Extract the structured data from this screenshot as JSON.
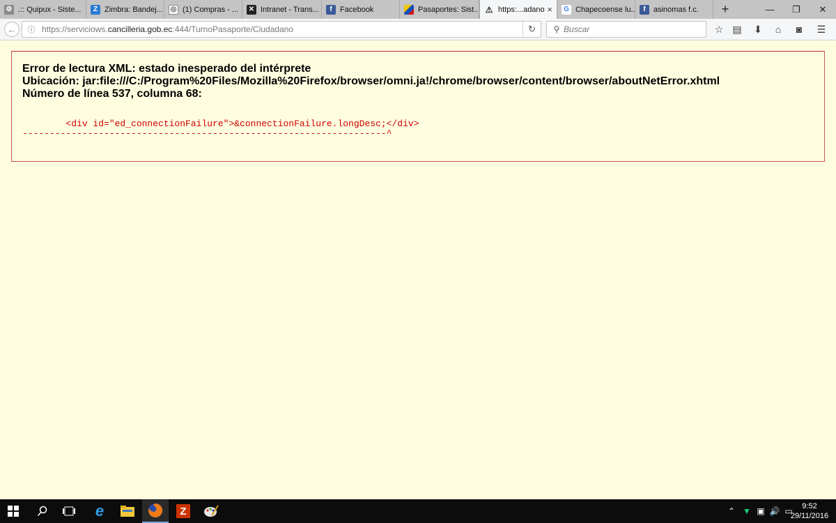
{
  "browser": {
    "tabs": [
      {
        "label": ".:: Quipux - Siste...",
        "icon": "quipux-icon",
        "color": "#6b6b6b"
      },
      {
        "label": "Zimbra: Bandej...",
        "icon": "zimbra-icon",
        "color": "#2b7bd1"
      },
      {
        "label": "(1) Compras - ...",
        "icon": "compras-icon",
        "color": "#7a7a7a"
      },
      {
        "label": "Intranet - Trans...",
        "icon": "intranet-icon",
        "color": "#222222"
      },
      {
        "label": "Facebook",
        "icon": "facebook-icon",
        "color": "#3b5998"
      },
      {
        "label": "Pasaportes: Sist...",
        "icon": "pasaportes-icon",
        "color": "#e0a000"
      },
      {
        "label": "https:...adano",
        "icon": "warning-icon",
        "color": "#e6b800",
        "active": true
      },
      {
        "label": "Chapecoense lu...",
        "icon": "google-icon",
        "color": "#4285f4"
      },
      {
        "label": "asinomas f.c.",
        "icon": "facebook-icon",
        "color": "#3b5998"
      }
    ],
    "new_tab_label": "+",
    "url": {
      "prefix": "https://serviciows.",
      "domain": "cancilleria.gob.ec",
      "path": ":444/TurnoPasaporte/Ciudadano"
    },
    "search_placeholder": "Buscar"
  },
  "error": {
    "line1": "Error de lectura XML: estado inesperado del intérprete",
    "line2": "Ubicación: jar:file:///C:/Program%20Files/Mozilla%20Firefox/browser/omni.ja!/chrome/browser/content/browser/aboutNetError.xhtml",
    "line3": "Número de línea 537, columna 68:",
    "source_line": "        <div id=\"ed_connectionFailure\">&connectionFailure.longDesc;</div>",
    "pointer_line": "-------------------------------------------------------------------^"
  },
  "taskbar": {
    "time": "9:52",
    "date": "29/11/2016"
  }
}
